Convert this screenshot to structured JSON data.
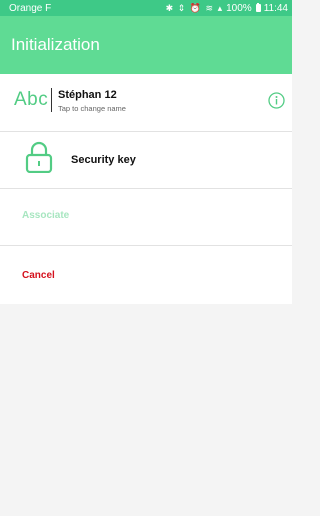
{
  "status_bar": {
    "carrier": "Orange F",
    "battery_percent": "100%",
    "time": "11:44"
  },
  "app_bar": {
    "title": "Initialization"
  },
  "device_name": {
    "icon_text": "Abc",
    "name": "Stéphan 12",
    "hint": "Tap to change name"
  },
  "security": {
    "label": "Security key"
  },
  "actions": {
    "associate_label": "Associate",
    "cancel_label": "Cancel"
  },
  "colors": {
    "accent": "#5fdb94",
    "status_bar": "#3ec987",
    "associate_disabled": "#a7e6c0",
    "cancel": "#d4101c"
  },
  "icons": [
    "bluetooth-icon",
    "vibrate-icon",
    "alarm-icon",
    "wifi-icon",
    "signal-icon",
    "battery-icon",
    "abc-icon",
    "info-icon",
    "lock-icon"
  ]
}
